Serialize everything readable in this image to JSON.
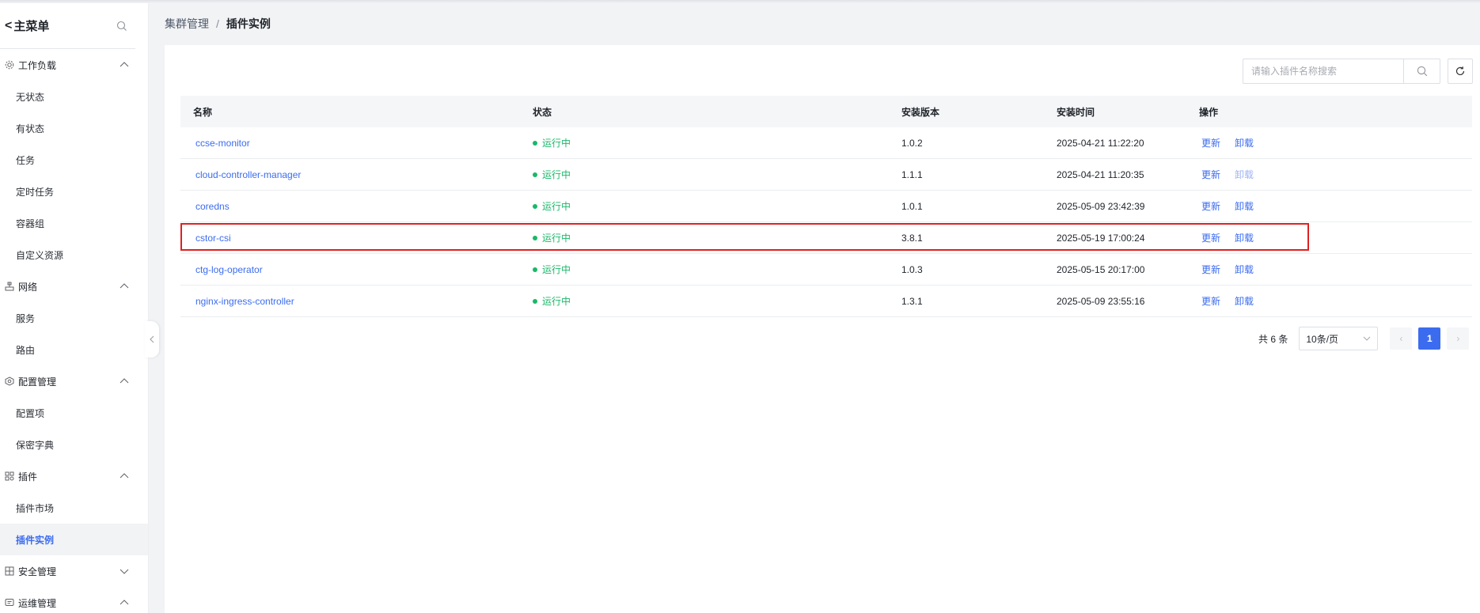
{
  "sidebar": {
    "back_glyph": "<",
    "title": "主菜单",
    "groups": [
      {
        "label": "工作负载",
        "icon": "workload-icon",
        "expanded": true,
        "items": [
          {
            "label": "无状态"
          },
          {
            "label": "有状态"
          },
          {
            "label": "任务"
          },
          {
            "label": "定时任务"
          },
          {
            "label": "容器组"
          },
          {
            "label": "自定义资源"
          }
        ]
      },
      {
        "label": "网络",
        "icon": "network-icon",
        "expanded": true,
        "items": [
          {
            "label": "服务"
          },
          {
            "label": "路由"
          }
        ]
      },
      {
        "label": "配置管理",
        "icon": "config-icon",
        "expanded": true,
        "items": [
          {
            "label": "配置项"
          },
          {
            "label": "保密字典"
          }
        ]
      },
      {
        "label": "插件",
        "icon": "plugin-icon",
        "expanded": true,
        "items": [
          {
            "label": "插件市场"
          },
          {
            "label": "插件实例",
            "active": true
          }
        ]
      },
      {
        "label": "安全管理",
        "icon": "security-icon",
        "expanded": false,
        "items": []
      },
      {
        "label": "运维管理",
        "icon": "ops-icon",
        "expanded": true,
        "items": []
      }
    ]
  },
  "breadcrumb": {
    "parent": "集群管理",
    "separator": "/",
    "current": "插件实例"
  },
  "search": {
    "placeholder": "请输入插件名称搜索",
    "value": ""
  },
  "table": {
    "headers": {
      "name": "名称",
      "status": "状态",
      "version": "安装版本",
      "time": "安装时间",
      "ops": "操作"
    },
    "rows": [
      {
        "name": "ccse-monitor",
        "status": "运行中",
        "version": "1.0.2",
        "time": "2025-04-21 11:22:20",
        "update": "更新",
        "uninstall": "卸载",
        "uninstall_disabled": false,
        "highlighted": false
      },
      {
        "name": "cloud-controller-manager",
        "status": "运行中",
        "version": "1.1.1",
        "time": "2025-04-21 11:20:35",
        "update": "更新",
        "uninstall": "卸载",
        "uninstall_disabled": true,
        "highlighted": false
      },
      {
        "name": "coredns",
        "status": "运行中",
        "version": "1.0.1",
        "time": "2025-05-09 23:42:39",
        "update": "更新",
        "uninstall": "卸载",
        "uninstall_disabled": false,
        "highlighted": false
      },
      {
        "name": "cstor-csi",
        "status": "运行中",
        "version": "3.8.1",
        "time": "2025-05-19 17:00:24",
        "update": "更新",
        "uninstall": "卸载",
        "uninstall_disabled": false,
        "highlighted": true
      },
      {
        "name": "ctg-log-operator",
        "status": "运行中",
        "version": "1.0.3",
        "time": "2025-05-15 20:17:00",
        "update": "更新",
        "uninstall": "卸载",
        "uninstall_disabled": false,
        "highlighted": false
      },
      {
        "name": "nginx-ingress-controller",
        "status": "运行中",
        "version": "1.3.1",
        "time": "2025-05-09 23:55:16",
        "update": "更新",
        "uninstall": "卸载",
        "uninstall_disabled": false,
        "highlighted": false
      }
    ]
  },
  "pagination": {
    "total": "共 6 条",
    "page_size": "10条/页",
    "current_page": "1",
    "prev_glyph": "‹",
    "next_glyph": "›"
  },
  "colors": {
    "accent": "#3b6cf0",
    "status_running": "#19b868",
    "highlight_border": "#e02020"
  }
}
